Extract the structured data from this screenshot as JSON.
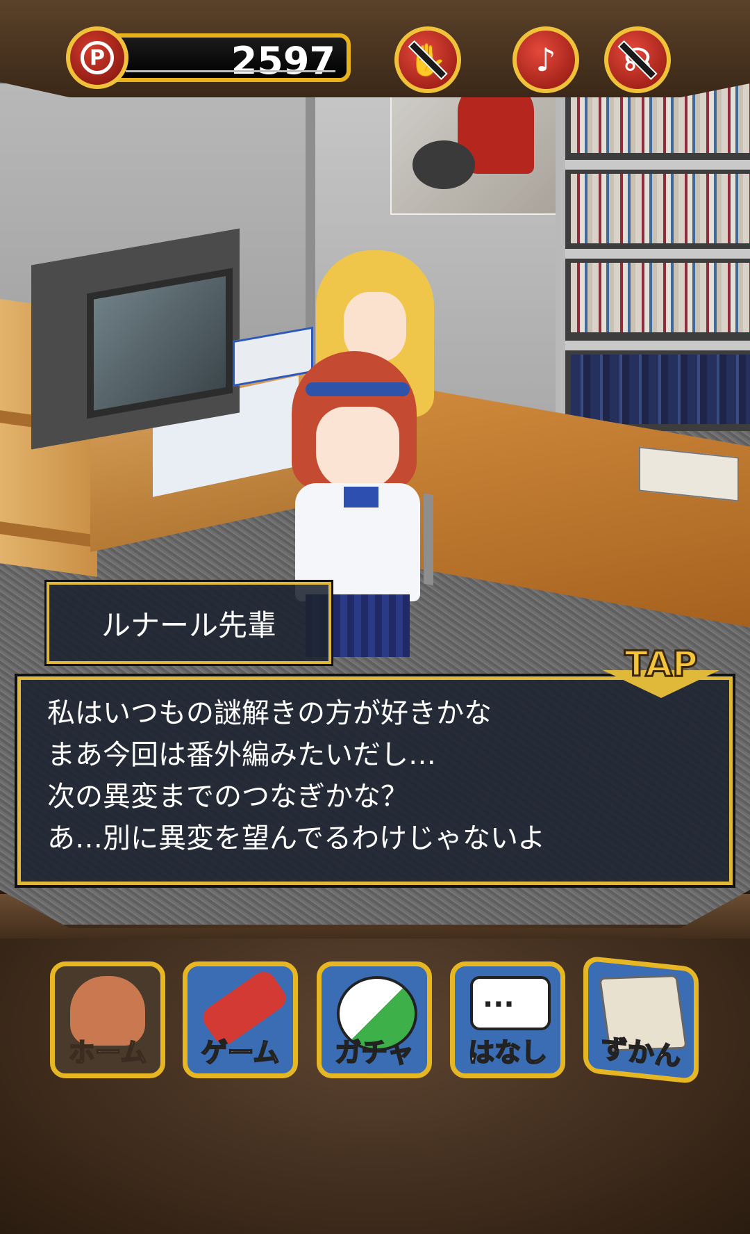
{
  "hud": {
    "points_symbol": "P",
    "points": "2597",
    "buttons": [
      {
        "name": "vibration-off-button",
        "icon": "vibration-off-icon"
      },
      {
        "name": "music-toggle-button",
        "icon": "music-note-icon",
        "glyph": "♪"
      },
      {
        "name": "sound-off-button",
        "icon": "sound-off-icon"
      }
    ]
  },
  "dialog": {
    "speaker": "ルナール先輩",
    "tap_label": "TAP",
    "lines": [
      "私はいつもの謎解きの方が好きかな",
      "まあ今回は番外編みたいだし…",
      "次の異変までのつなぎかな？",
      "あ…別に異変を望んでるわけじゃないよ"
    ]
  },
  "nav": {
    "home": "ホーム",
    "game": "ゲーム",
    "gacha": "ガチャ",
    "talk": "はなし",
    "book": "ずかん"
  },
  "colors": {
    "accent_gold": "#e0b93a",
    "button_red": "#d23b2c",
    "dialog_bg": "#1e2432"
  }
}
